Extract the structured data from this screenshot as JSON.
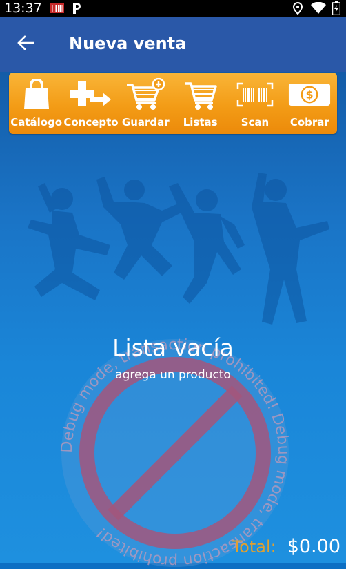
{
  "status_bar": {
    "time": "13:37",
    "icons": [
      "barcode-app-icon",
      "parking-icon",
      "location-icon",
      "wifi-icon",
      "battery-icon"
    ]
  },
  "app_bar": {
    "title": "Nueva venta",
    "back_icon": "arrow-left-icon"
  },
  "toolbar": {
    "background": "#f39c16",
    "items": [
      {
        "label": "Catálogo",
        "icon": "bag-icon"
      },
      {
        "label": "Concepto",
        "icon": "add-concept-icon"
      },
      {
        "label": "Guardar",
        "icon": "cart-add-icon"
      },
      {
        "label": "Listas",
        "icon": "cart-list-icon"
      },
      {
        "label": "Scan",
        "icon": "barcode-scan-icon"
      },
      {
        "label": "Cobrar",
        "icon": "cash-icon"
      }
    ]
  },
  "empty_state": {
    "title": "Lista vacía",
    "subtitle": "agrega un producto"
  },
  "watermark": {
    "text": "Debug mode, transaction prohibited! Debug mode, transaction prohibited!",
    "icon": "prohibited-icon"
  },
  "total": {
    "label": "Total:",
    "value": "$0.00"
  },
  "colors": {
    "app_bar": "#2a58a8",
    "accent": "#f39c16",
    "total_label": "#e0a030"
  }
}
